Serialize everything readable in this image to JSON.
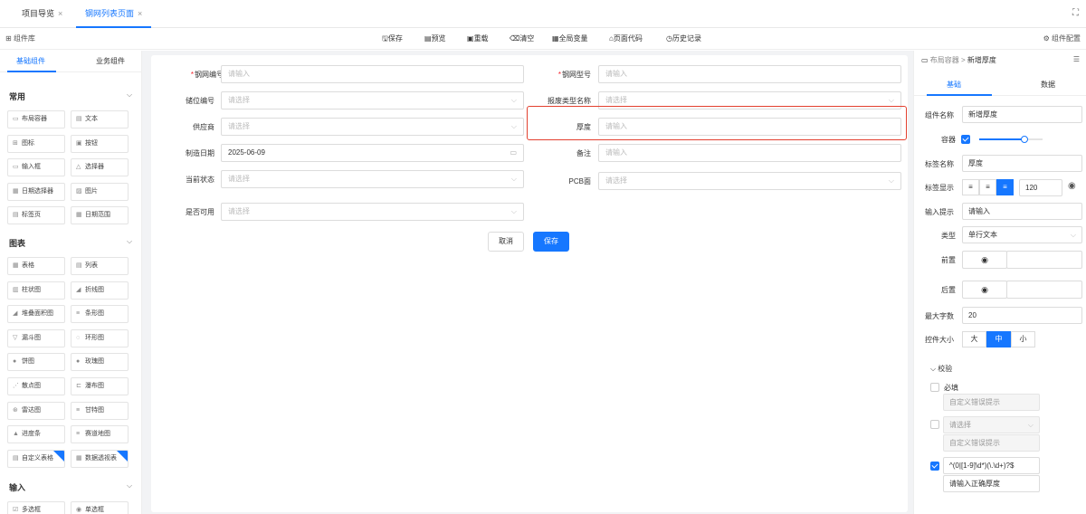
{
  "tabs": [
    {
      "label": "项目导览",
      "close": "×"
    },
    {
      "label": "钢网列表页面",
      "close": "×"
    }
  ],
  "toolbar": {
    "library": "组件库",
    "save": "保存",
    "preview": "预览",
    "reload": "重载",
    "clear": "清空",
    "global_vars": "全局变量",
    "page_code": "页面代码",
    "history": "历史记录",
    "config": "组件配置"
  },
  "left_panel": {
    "tabs": [
      "基础组件",
      "业务组件"
    ],
    "sections": [
      {
        "title": "常用",
        "items": [
          "布局容器",
          "文本",
          "图标",
          "按钮",
          "输入框",
          "选择器",
          "日期选择器",
          "图片",
          "标签页",
          "日期范围"
        ]
      },
      {
        "title": "图表",
        "items": [
          "表格",
          "列表",
          "柱状图",
          "折线图",
          "堆叠面积图",
          "条形图",
          "漏斗图",
          "环形图",
          "饼图",
          "玫瑰图",
          "散点图",
          "瀑布图",
          "雷达图",
          "甘特图",
          "进度条",
          "赛道地图",
          "自定义表格",
          "数据透视表"
        ]
      },
      {
        "title": "输入",
        "items": [
          "多选框",
          "单选框"
        ]
      }
    ]
  },
  "form": {
    "fields": [
      {
        "label": "钢网编号",
        "required": true,
        "placeholder": "请输入"
      },
      {
        "label": "钢网型号",
        "required": true,
        "placeholder": "请输入"
      },
      {
        "label": "储位编号",
        "placeholder": "请选择"
      },
      {
        "label": "报废类型名称",
        "placeholder": "请选择"
      },
      {
        "label": "供应商",
        "placeholder": "请选择"
      },
      {
        "label": "厚度",
        "placeholder": "请输入"
      },
      {
        "label": "制造日期",
        "value": "2025-06-09"
      },
      {
        "label": "备注",
        "placeholder": "请输入"
      },
      {
        "label": "当前状态",
        "placeholder": "请选择"
      },
      {
        "label": "PCB面",
        "placeholder": "请选择"
      },
      {
        "label": "是否可用",
        "placeholder": "请选择"
      }
    ],
    "cancel": "取消",
    "save": "保存"
  },
  "right_panel": {
    "breadcrumb": {
      "parent": "布局容器",
      "sep": ">",
      "current": "新增厚度"
    },
    "tabs": [
      "基础",
      "数据"
    ],
    "component_name": {
      "label": "组件名称",
      "value": "新增厚度"
    },
    "container": {
      "label": "容器",
      "slider": 0.72
    },
    "tag_name": {
      "label": "标签名称",
      "value": "厚度"
    },
    "tag_display": {
      "label": "标签显示",
      "width": "120"
    },
    "input_hint": {
      "label": "输入提示",
      "value": "请输入"
    },
    "type": {
      "label": "类型",
      "value": "单行文本"
    },
    "prefix": {
      "label": "前置"
    },
    "suffix": {
      "label": "后置"
    },
    "max_chars": {
      "label": "最大字数",
      "value": "20"
    },
    "size": {
      "label": "控件大小",
      "options": [
        "大",
        "中",
        "小"
      ],
      "selected": "中"
    },
    "validation": {
      "title": "校验",
      "required": "必填",
      "custom_error": "自定义错误提示",
      "select_placeholder": "请选择",
      "regex": "^(0|[1-9]\\d*)(\\.\\d+)?$",
      "regex_msg": "请输入正确厚度"
    }
  }
}
